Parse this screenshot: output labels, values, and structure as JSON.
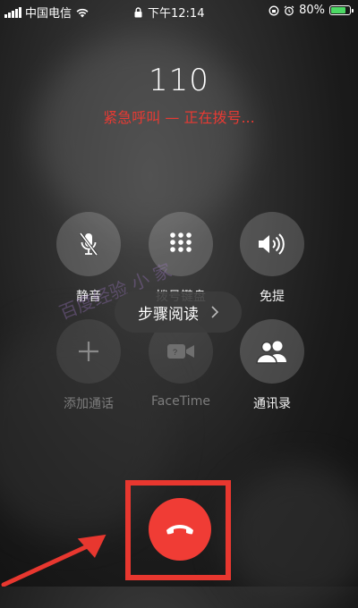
{
  "status_bar": {
    "carrier": "中国电信",
    "time": "下午12:14",
    "battery": "80%",
    "battery_level": 0.8,
    "battery_color": "#4cd964"
  },
  "call": {
    "number": "110",
    "status": "紧急呼叫 — 正在拨号...",
    "status_color": "#e83a33"
  },
  "controls": {
    "mute": {
      "label": "静音",
      "icon": "mic-off-icon"
    },
    "keypad": {
      "label": "拨号键盘",
      "icon": "keypad-icon"
    },
    "speaker": {
      "label": "免提",
      "icon": "speaker-icon"
    },
    "add_call": {
      "label": "添加通话",
      "icon": "plus-icon"
    },
    "facetime": {
      "label": "FaceTime",
      "icon": "video-icon"
    },
    "contacts": {
      "label": "通讯录",
      "icon": "contacts-icon"
    }
  },
  "tooltip": {
    "label": "步骤阅读",
    "icon": "chevron-right-icon"
  },
  "watermark": {
    "text": "百度经验 小 家"
  },
  "end_call": {
    "icon": "hang-up-icon",
    "color": "#f03c35"
  },
  "annotations": {
    "highlight_color": "#e8372f",
    "arrow_color": "#e8372f"
  }
}
